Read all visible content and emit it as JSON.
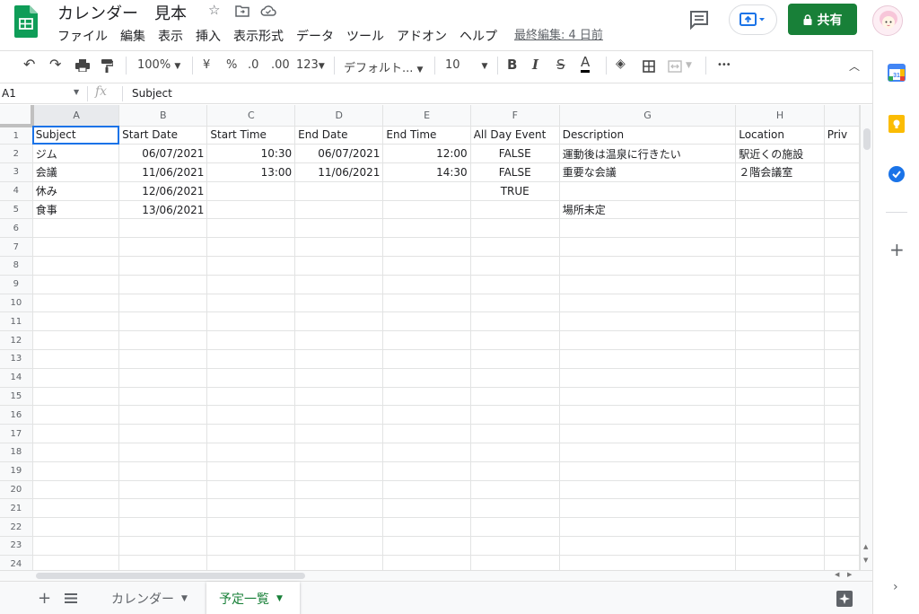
{
  "header": {
    "title": "カレンダー　見本",
    "last_edit": "最終編集: 4 日前",
    "share_label": "共有",
    "menu": [
      "ファイル",
      "編集",
      "表示",
      "挿入",
      "表示形式",
      "データ",
      "ツール",
      "アドオン",
      "ヘルプ"
    ]
  },
  "toolbar": {
    "zoom": "100%",
    "currency": "¥",
    "percent": "%",
    "dec_less": ".0",
    "dec_more": ".00",
    "format_more": "123",
    "font": "デフォルト...",
    "font_size": "10",
    "bold": "B",
    "italic": "I",
    "strike": "S",
    "text_color": "A",
    "more": "•••"
  },
  "formula_bar": {
    "cell_ref": "A1",
    "fx": "fx",
    "content": "Subject"
  },
  "grid": {
    "columns": [
      "A",
      "B",
      "C",
      "D",
      "E",
      "F",
      "G",
      "H",
      ""
    ],
    "row_numbers": [
      "1",
      "2",
      "3",
      "4",
      "5",
      "6",
      "7",
      "8",
      "9",
      "10",
      "11",
      "12",
      "13",
      "14",
      "15",
      "16",
      "17",
      "18",
      "19",
      "20",
      "21",
      "22",
      "23",
      "24"
    ],
    "rows": [
      [
        "Subject",
        "Start Date",
        "Start Time",
        "End Date",
        "End Time",
        "All Day Event",
        "Description",
        "Location",
        "Priv"
      ],
      [
        "ジム",
        "06/07/2021",
        "10:30",
        "06/07/2021",
        "12:00",
        "FALSE",
        "運動後は温泉に行きたい",
        "駅近くの施設",
        ""
      ],
      [
        "会議",
        "11/06/2021",
        "13:00",
        "11/06/2021",
        "14:30",
        "FALSE",
        "重要な会議",
        "２階会議室",
        ""
      ],
      [
        "休み",
        "12/06/2021",
        "",
        "",
        "",
        "TRUE",
        "",
        "",
        ""
      ],
      [
        "食事",
        "13/06/2021",
        "",
        "",
        "",
        "",
        "場所未定",
        "",
        ""
      ]
    ]
  },
  "sheets": {
    "tabs": [
      "カレンダー",
      "予定一覧"
    ],
    "active": "予定一覧"
  },
  "colors": {
    "brand_green": "#188038",
    "selection_blue": "#1a73e8"
  }
}
